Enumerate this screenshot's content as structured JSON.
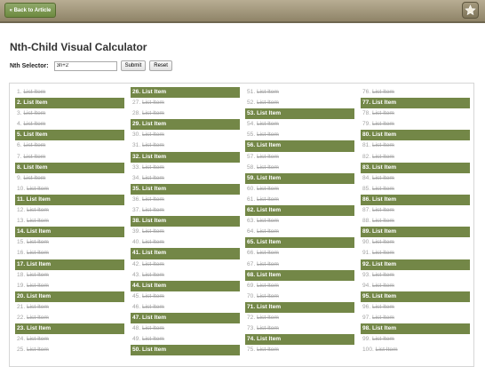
{
  "header": {
    "back_label": "« Back to Article",
    "star_icon": "star-icon"
  },
  "page": {
    "title": "Nth-Child Visual Calculator"
  },
  "selector": {
    "label": "Nth Selector:",
    "value": "3n+2",
    "submit_label": "Submit",
    "reset_label": "Reset"
  },
  "list": {
    "item_text": "List Item",
    "count": 100,
    "rows_per_column": 25,
    "highlight_color": "#738747",
    "highlighted": [
      2,
      5,
      8,
      11,
      14,
      17,
      20,
      23,
      26,
      29,
      32,
      35,
      38,
      41,
      44,
      47,
      50,
      53,
      56,
      59,
      62,
      65,
      68,
      71,
      74,
      77,
      80,
      83,
      86,
      89,
      92,
      95,
      98
    ]
  }
}
